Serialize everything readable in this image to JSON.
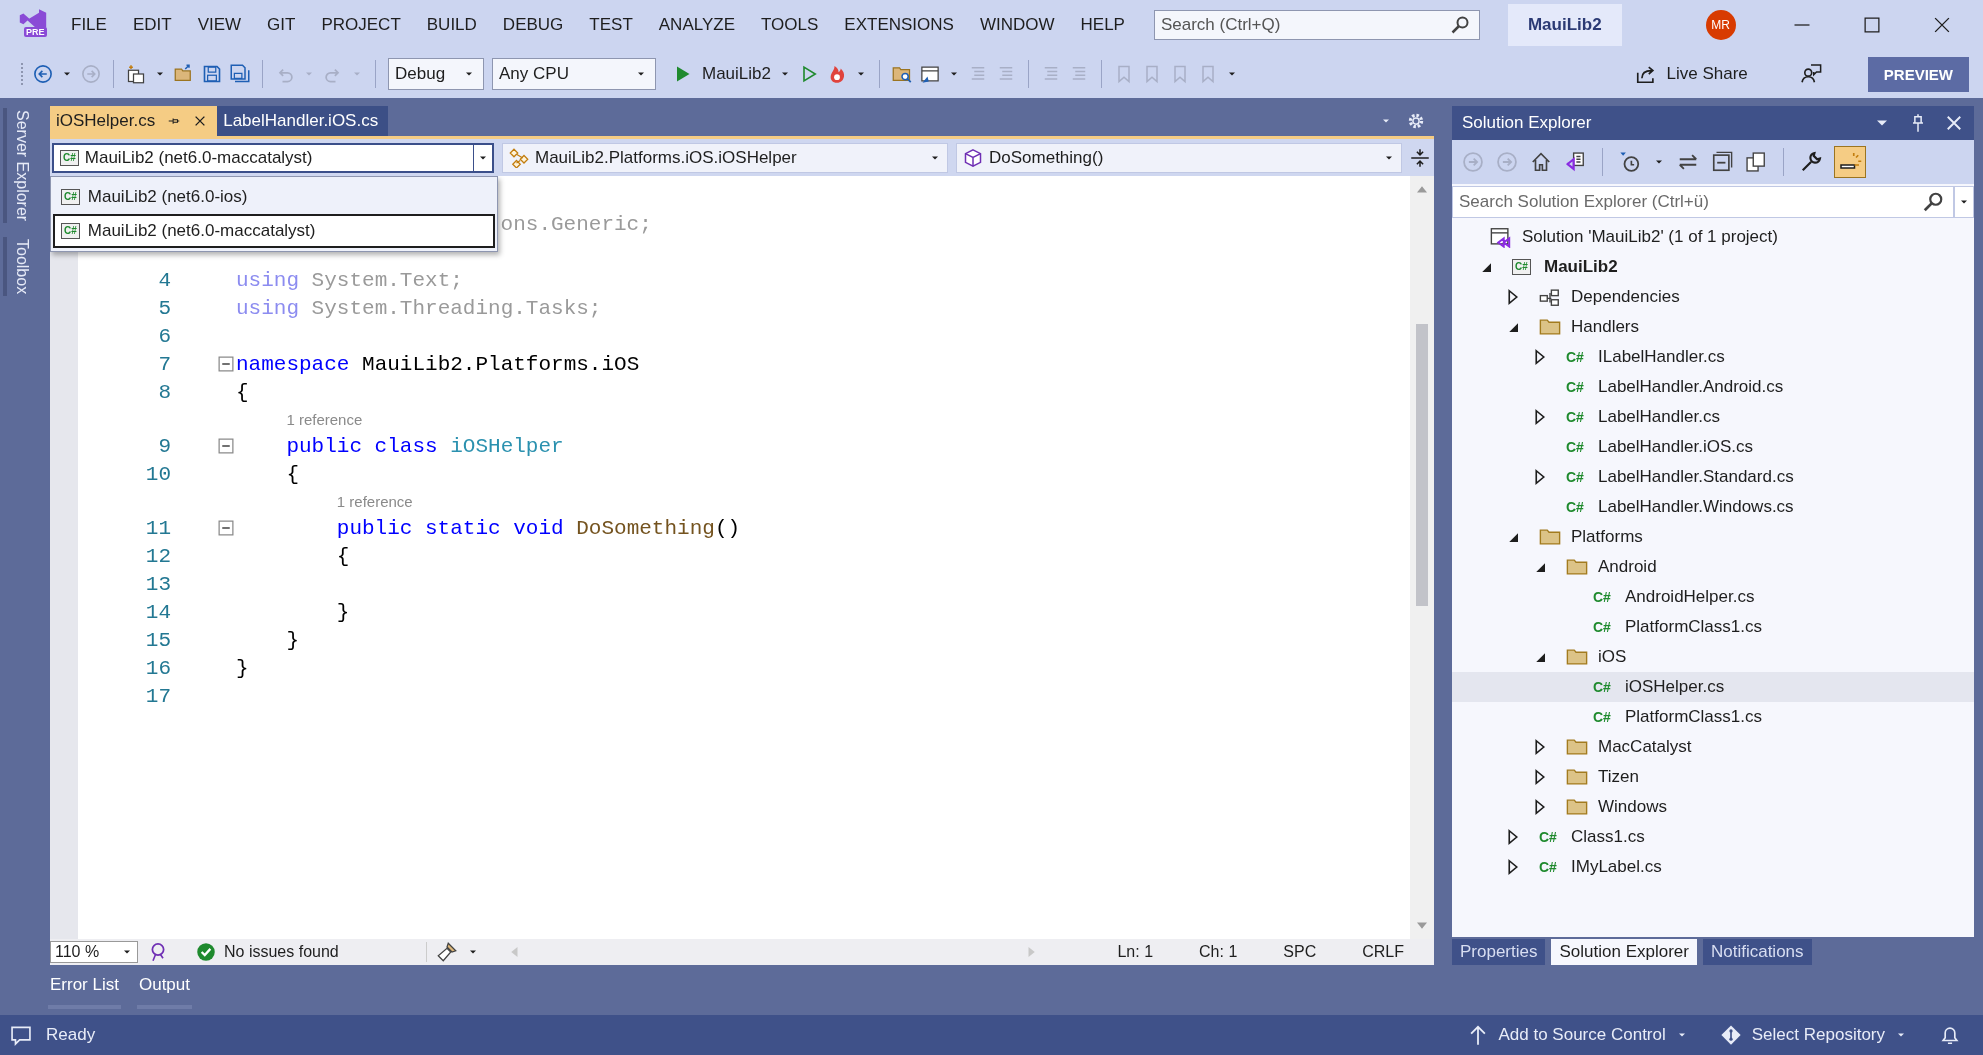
{
  "menu_bar": {
    "logo_badge": "PRE",
    "items": [
      "FILE",
      "EDIT",
      "VIEW",
      "GIT",
      "PROJECT",
      "BUILD",
      "DEBUG",
      "TEST",
      "ANALYZE",
      "TOOLS",
      "EXTENSIONS",
      "WINDOW",
      "HELP"
    ],
    "search": {
      "placeholder": "Search (Ctrl+Q)"
    },
    "solution_name": "MauiLib2",
    "avatar": "MR"
  },
  "toolbar": {
    "configuration": "Debug",
    "platform": "Any CPU",
    "start_target": "MauiLib2",
    "live_share": "Live Share",
    "preview": "PREVIEW"
  },
  "side_tabs": [
    "Server Explorer",
    "Toolbox"
  ],
  "document_tabs": [
    {
      "label": "iOSHelper.cs",
      "selected": true
    },
    {
      "label": "LabelHandler.iOS.cs",
      "selected": false
    }
  ],
  "navigation_bar": {
    "project": {
      "icon_text": "C#",
      "value": "MauiLib2 (net6.0-maccatalyst)",
      "expanded": true,
      "options": [
        {
          "icon_text": "C#",
          "label": "MauiLib2 (net6.0-ios)",
          "selected": false
        },
        {
          "icon_text": "C#",
          "label": "MauiLib2 (net6.0-maccatalyst)",
          "selected": true
        }
      ]
    },
    "type": "MauiLib2.Platforms.iOS.iOSHelper",
    "member": "DoSomething()"
  },
  "editor": {
    "lines": [
      {
        "tokens": [
          {
            "text": "                     ons.Generic;",
            "kind": "faded"
          }
        ]
      },
      {
        "number": "4",
        "tokens": [
          {
            "text": "using",
            "kind": "faded-keyword"
          },
          {
            "text": " System.Text;",
            "kind": "faded"
          }
        ]
      },
      {
        "number": "5",
        "tokens": [
          {
            "text": "using",
            "kind": "faded-keyword"
          },
          {
            "text": " System.Threading.Tasks;",
            "kind": "faded"
          }
        ]
      },
      {
        "number": "6"
      },
      {
        "number": "7",
        "fold": true,
        "tokens": [
          {
            "text": "namespace",
            "kind": "keyword"
          },
          {
            "text": " MauiLib2.Platforms.iOS",
            "kind": "plain"
          }
        ]
      },
      {
        "number": "8",
        "tokens": [
          {
            "text": "{",
            "kind": "plain"
          }
        ]
      },
      {
        "number": "9",
        "fold": true,
        "codelens": "1 reference",
        "tokens": [
          {
            "text": "    public class",
            "kind": "keyword"
          },
          {
            "text": " iOSHelper",
            "kind": "type"
          }
        ]
      },
      {
        "number": "10",
        "tokens": [
          {
            "text": "    {",
            "kind": "plain"
          }
        ]
      },
      {
        "number": "11",
        "fold": true,
        "codelens": "1 reference",
        "tokens": [
          {
            "text": "        public static void",
            "kind": "keyword"
          },
          {
            "text": " DoSomething",
            "kind": "method"
          },
          {
            "text": "()",
            "kind": "plain"
          }
        ]
      },
      {
        "number": "12",
        "tokens": [
          {
            "text": "        {",
            "kind": "plain"
          }
        ]
      },
      {
        "number": "13"
      },
      {
        "number": "14",
        "tokens": [
          {
            "text": "        }",
            "kind": "plain"
          }
        ]
      },
      {
        "number": "15",
        "tokens": [
          {
            "text": "    }",
            "kind": "plain"
          }
        ]
      },
      {
        "number": "16",
        "tokens": [
          {
            "text": "}",
            "kind": "plain"
          }
        ]
      },
      {
        "number": "17"
      }
    ]
  },
  "editor_status": {
    "zoom": "110 %",
    "issues": "No issues found",
    "line": "Ln: 1",
    "column": "Ch: 1",
    "whitespace": "SPC",
    "line_endings": "CRLF"
  },
  "tool_tabs": [
    "Error List",
    "Output"
  ],
  "solution_explorer": {
    "title": "Solution Explorer",
    "search": {
      "placeholder": "Search Solution Explorer (Ctrl+ü)"
    },
    "tree": [
      {
        "label": "Solution 'MauiLib2' (1 of 1 project)",
        "kind": "solution",
        "selected": false,
        "children": [
          {
            "label": "MauiLib2",
            "kind": "project",
            "icon_text": "C#",
            "expanded": true,
            "selected": false,
            "children": [
              {
                "label": "Dependencies",
                "kind": "dependencies",
                "expanded": false,
                "selected": false
              },
              {
                "label": "Handlers",
                "kind": "folder",
                "expanded": true,
                "selected": false,
                "children": [
                  {
                    "label": "ILabelHandler.cs",
                    "kind": "csfile",
                    "icon_text": "C#",
                    "expanded": false,
                    "selected": false
                  },
                  {
                    "label": "LabelHandler.Android.cs",
                    "kind": "csfile",
                    "icon_text": "C#",
                    "selected": false
                  },
                  {
                    "label": "LabelHandler.cs",
                    "kind": "csfile",
                    "icon_text": "C#",
                    "expanded": false,
                    "selected": false
                  },
                  {
                    "label": "LabelHandler.iOS.cs",
                    "kind": "csfile",
                    "icon_text": "C#",
                    "selected": false
                  },
                  {
                    "label": "LabelHandler.Standard.cs",
                    "kind": "csfile",
                    "icon_text": "C#",
                    "expanded": false,
                    "selected": false
                  },
                  {
                    "label": "LabelHandler.Windows.cs",
                    "kind": "csfile",
                    "icon_text": "C#",
                    "selected": false
                  }
                ]
              },
              {
                "label": "Platforms",
                "kind": "folder",
                "expanded": true,
                "selected": false,
                "children": [
                  {
                    "label": "Android",
                    "kind": "folder",
                    "expanded": true,
                    "selected": false,
                    "children": [
                      {
                        "label": "AndroidHelper.cs",
                        "kind": "csfile",
                        "icon_text": "C#",
                        "selected": false
                      },
                      {
                        "label": "PlatformClass1.cs",
                        "kind": "csfile",
                        "icon_text": "C#",
                        "selected": false
                      }
                    ]
                  },
                  {
                    "label": "iOS",
                    "kind": "folder",
                    "expanded": true,
                    "selected": false,
                    "children": [
                      {
                        "label": "iOSHelper.cs",
                        "kind": "csfile",
                        "icon_text": "C#",
                        "selected": true
                      },
                      {
                        "label": "PlatformClass1.cs",
                        "kind": "csfile",
                        "icon_text": "C#",
                        "selected": false
                      }
                    ]
                  },
                  {
                    "label": "MacCatalyst",
                    "kind": "folder",
                    "expanded": false,
                    "selected": false
                  },
                  {
                    "label": "Tizen",
                    "kind": "folder",
                    "expanded": false,
                    "selected": false
                  },
                  {
                    "label": "Windows",
                    "kind": "folder",
                    "expanded": false,
                    "selected": false
                  }
                ]
              },
              {
                "label": "Class1.cs",
                "kind": "csfile",
                "icon_text": "C#",
                "expanded": false,
                "selected": false
              },
              {
                "label": "IMyLabel.cs",
                "kind": "csfile",
                "icon_text": "C#",
                "expanded": false,
                "selected": false
              }
            ]
          }
        ]
      }
    ],
    "tabs": [
      {
        "label": "Properties",
        "selected": false
      },
      {
        "label": "Solution Explorer",
        "selected": true
      },
      {
        "label": "Notifications",
        "selected": false
      }
    ]
  },
  "status_bar": {
    "message": "Ready",
    "source_control": "Add to Source Control",
    "repository": "Select Repository"
  }
}
